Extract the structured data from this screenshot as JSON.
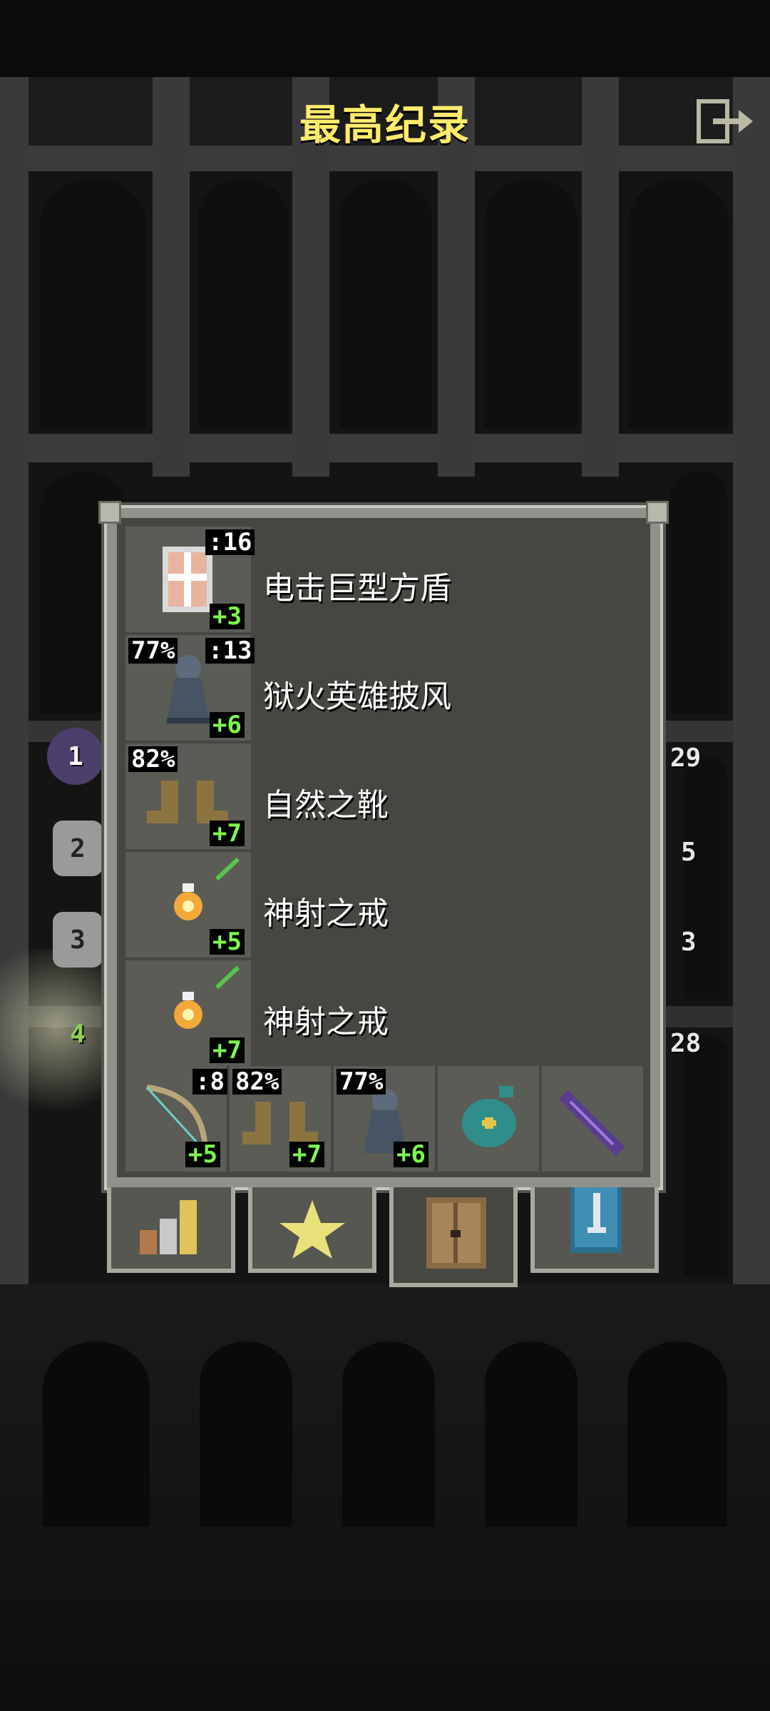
{
  "header": {
    "title": "最高纪录",
    "exit_icon": "exit-icon"
  },
  "side_ranks": [
    "1",
    "2",
    "3",
    "4"
  ],
  "right_badges": [
    "29",
    "5",
    "3",
    "28"
  ],
  "items": [
    {
      "name": "电击巨型方盾",
      "icon": "shield-icon",
      "top_right": ":16",
      "bottom_right": "+3"
    },
    {
      "name": "狱火英雄披风",
      "icon": "cloak-icon",
      "top_left": "77%",
      "top_right": ":13",
      "bottom_right": "+6"
    },
    {
      "name": "自然之靴",
      "icon": "boots-icon",
      "top_left": "82%",
      "bottom_right": "+7"
    },
    {
      "name": "神射之戒",
      "icon": "ring-icon",
      "bottom_right": "+5"
    },
    {
      "name": "神射之戒",
      "icon": "ring-icon",
      "bottom_right": "+7"
    }
  ],
  "quickslots": [
    {
      "icon": "bow-icon",
      "top_right": ":8",
      "bottom_right": "+5"
    },
    {
      "icon": "boots-icon",
      "top_left": "82%",
      "bottom_right": "+7"
    },
    {
      "icon": "cloak-icon",
      "top_left": "77%",
      "bottom_right": "+6"
    },
    {
      "icon": "seed-pouch-icon"
    },
    {
      "icon": "wand-icon"
    }
  ],
  "tabs": [
    {
      "name": "stats-tab",
      "icon": "bar-chart-icon",
      "active": false
    },
    {
      "name": "badges-tab",
      "icon": "star-icon",
      "active": false
    },
    {
      "name": "items-tab",
      "icon": "backpack-icon",
      "active": true
    },
    {
      "name": "class-tab",
      "icon": "sword-banner-icon",
      "active": false
    }
  ],
  "colors": {
    "title": "#ffec6b",
    "upgrade_green": "#7cfc4c",
    "panel": "#454741"
  }
}
